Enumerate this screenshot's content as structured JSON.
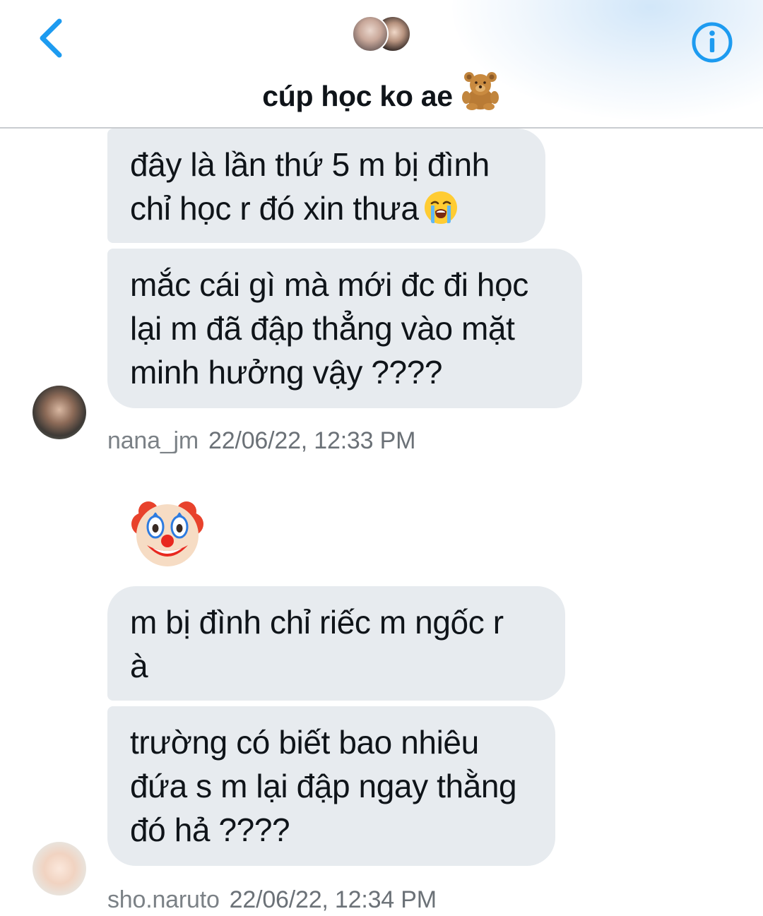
{
  "header": {
    "title": "cúp học ko ae",
    "title_emoji": "teddy-bear",
    "accent_color": "#1d9bf0"
  },
  "messages": [
    {
      "lines": [
        "đây là lần thứ 5 m bị đình",
        "chỉ học r đó xin thưa"
      ],
      "trailing_emoji": "loudly-crying-face"
    },
    {
      "lines": [
        "mắc cái gì mà mới đc đi học",
        "lại m đã đập thẳng vào mặt",
        "minh hưởng vậy ????"
      ]
    },
    {
      "lines": [
        "m bị đình chỉ riếc m ngốc r",
        "à"
      ]
    },
    {
      "lines": [
        "trường có biết bao nhiêu",
        "đứa s m lại đập ngay thằng",
        "đó hả ????"
      ]
    }
  ],
  "groups": [
    {
      "username": "nana_jm",
      "timestamp": "22/06/22, 12:33 PM"
    },
    {
      "username": "sho.naruto",
      "timestamp": "22/06/22, 12:34 PM"
    }
  ],
  "standalone_emoji": "clown-face",
  "colors": {
    "bubble_bg": "#e7ebef",
    "text": "#0f1419",
    "meta_text": "#6b7177",
    "divider": "#c9ccd0"
  }
}
